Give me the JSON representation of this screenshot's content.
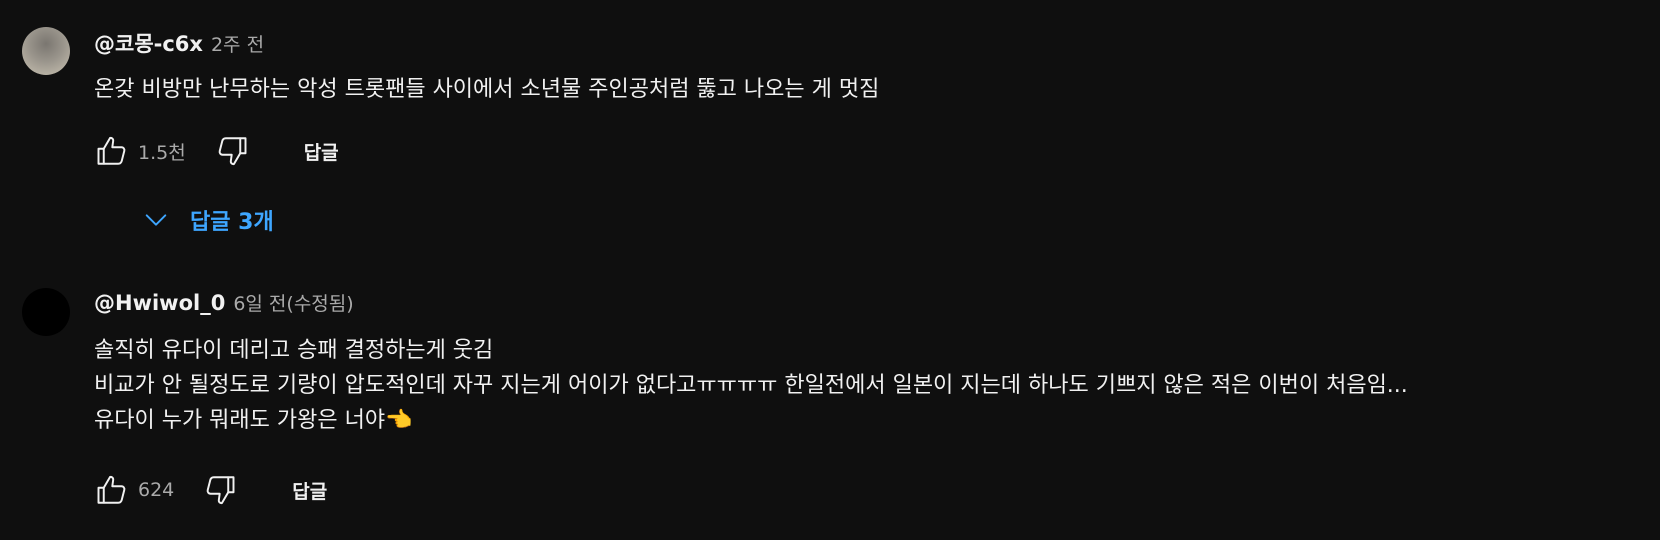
{
  "comments": [
    {
      "author": "@코몽-c6x",
      "time": "2주 전",
      "lines": [
        "온갖 비방만 난무하는 악성 트롯팬들 사이에서 소년물 주인공처럼 뚫고 나오는 게 멋짐"
      ],
      "likes": "1.5천",
      "reply_label": "답글",
      "replies_toggle": "답글 3개"
    },
    {
      "author": "@Hwiwol_0",
      "time": "6일 전(수정됨)",
      "lines": [
        "솔직히 유다이 데리고 승패 결정하는게 웃김",
        "비교가 안 될정도로 기량이 압도적인데 자꾸 지는게 어이가 없다고ㅠㅠㅠㅠ 한일전에서 일본이 지는데 하나도 기쁘지 않은 적은 이번이 처음임...",
        "유다이 누가 뭐래도 가왕은 너야👈"
      ],
      "likes": "624",
      "reply_label": "답글"
    }
  ],
  "icons": {
    "like": "thumb-up-icon",
    "dislike": "thumb-down-icon",
    "expand": "chevron-down-icon"
  },
  "colors": {
    "background": "#0f0f0f",
    "text": "#f1f1f1",
    "secondary_text": "#aaaaaa",
    "link": "#3ea6ff"
  }
}
